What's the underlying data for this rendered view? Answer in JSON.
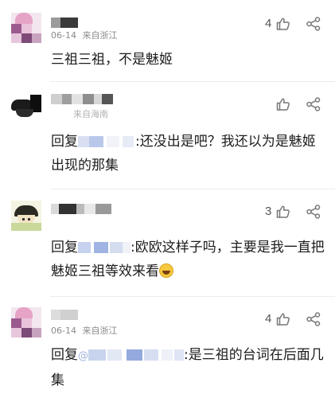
{
  "comments": [
    {
      "date_fragment": "06-14",
      "location": "来自浙江",
      "like_count": "4",
      "text": "三祖三祖，不是魅姬"
    },
    {
      "date_fragment": "",
      "location": "来自海南",
      "like_count": "",
      "reply_prefix": "回复",
      "text": ":还没出是吧？我还以为是魅姬出现的那集"
    },
    {
      "date_fragment": "",
      "location": "",
      "like_count": "3",
      "reply_prefix": "回复",
      "text": ":欧欧这样子吗，主要是我一直把魅姬三祖等效来看"
    },
    {
      "date_fragment": "06-14",
      "location": "来自浙江",
      "like_count": "4",
      "reply_prefix": "回复",
      "reply_at": "@",
      "text": ":是三祖的台词在后面几集"
    }
  ],
  "icons": {
    "like": "thumbs-up-icon",
    "share": "share-icon",
    "emoji": "laughing-face-emoji"
  }
}
